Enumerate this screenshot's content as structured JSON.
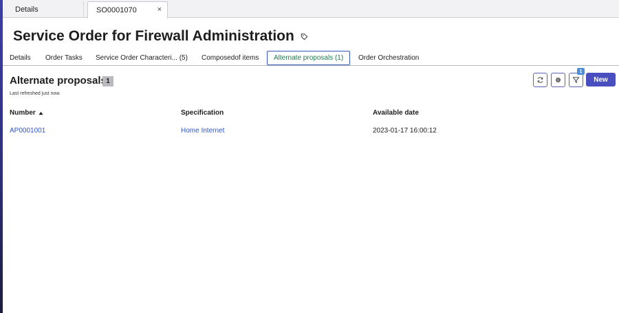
{
  "top_tabs": {
    "details_label": "Details",
    "active_label": "SO0001070",
    "close_glyph": "×"
  },
  "page": {
    "title": "Service Order for Firewall Administration",
    "title_icon": "tag-icon"
  },
  "section_tabs": [
    {
      "label": "Details"
    },
    {
      "label": "Order Tasks"
    },
    {
      "label": "Service Order Characteri... (5)"
    },
    {
      "label": "Composedof items"
    },
    {
      "label": "Alternate proposals (1)",
      "active": true
    },
    {
      "label": "Order Orchestration"
    }
  ],
  "section": {
    "heading": "Alternate proposals",
    "count": "1",
    "refresh_note": "Last refreshed just now."
  },
  "toolbar": {
    "refresh_icon": "refresh-icon",
    "settings_icon": "gear-icon",
    "filter_icon": "filter-icon",
    "filter_count": "1",
    "new_label": "New",
    "accent_color": "#4a4fbf"
  },
  "table": {
    "columns": [
      "Number",
      "Specification",
      "Available date"
    ],
    "sort_icon": "sort-ascending-icon",
    "rows": [
      {
        "number": "AP0001001",
        "specification": "Home Internet",
        "available_date": "2023-01-17 16:00:12"
      }
    ]
  }
}
